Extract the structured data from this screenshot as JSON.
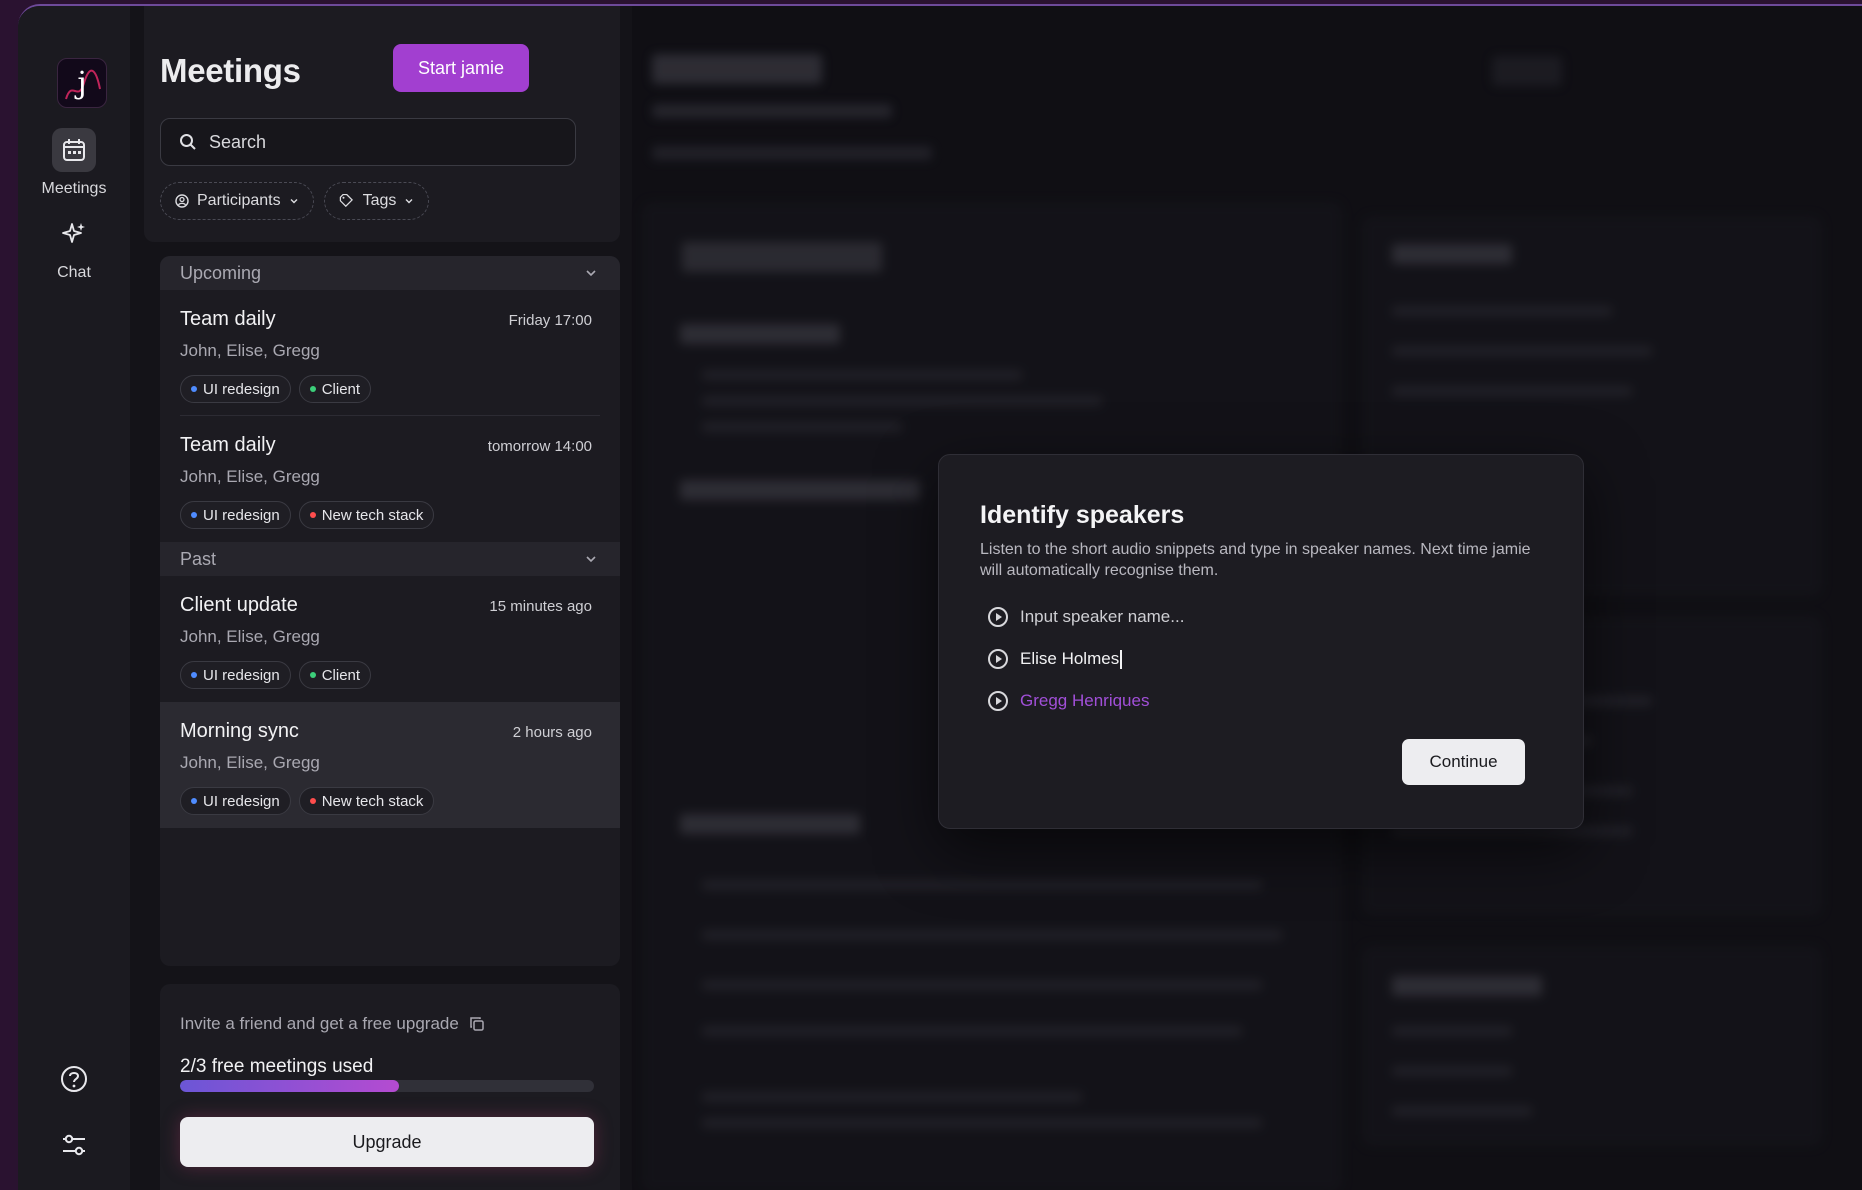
{
  "rail": {
    "logo_letter": "j",
    "items": [
      {
        "label": "Meetings",
        "icon": "calendar-icon",
        "active": true
      },
      {
        "label": "Chat",
        "icon": "sparkle-icon",
        "active": false
      }
    ],
    "bottom_icons": [
      "help-icon",
      "settings-sliders-icon"
    ]
  },
  "panel": {
    "title": "Meetings",
    "start_button": "Start jamie",
    "search_placeholder": "Search",
    "filters": [
      {
        "label": "Participants",
        "icon": "person-circle-icon"
      },
      {
        "label": "Tags",
        "icon": "tag-icon"
      }
    ]
  },
  "sections": {
    "upcoming": {
      "label": "Upcoming",
      "meetings": [
        {
          "title": "Team daily",
          "time": "Friday 17:00",
          "people": "John, Elise, Gregg",
          "tags": [
            {
              "label": "UI redesign",
              "color": "#4f8cff"
            },
            {
              "label": "Client",
              "color": "#3ccf7a"
            }
          ]
        },
        {
          "title": "Team daily",
          "time": "tomorrow 14:00",
          "people": "John, Elise, Gregg",
          "tags": [
            {
              "label": "UI redesign",
              "color": "#4f8cff"
            },
            {
              "label": "New tech stack",
              "color": "#ff4d4d"
            }
          ]
        }
      ]
    },
    "past": {
      "label": "Past",
      "meetings": [
        {
          "title": "Client update",
          "time": "15 minutes ago",
          "people": "John, Elise, Gregg",
          "tags": [
            {
              "label": "UI redesign",
              "color": "#4f8cff"
            },
            {
              "label": "Client",
              "color": "#3ccf7a"
            }
          ]
        },
        {
          "title": "Morning sync",
          "time": "2 hours ago",
          "people": "John, Elise, Gregg",
          "tags": [
            {
              "label": "UI redesign",
              "color": "#4f8cff"
            },
            {
              "label": "New tech stack",
              "color": "#ff4d4d"
            }
          ]
        }
      ]
    }
  },
  "promo": {
    "invite_text": "Invite a friend and get a free upgrade",
    "usage_text": "2/3 free meetings used",
    "usage_fraction": 0.53,
    "upgrade_button": "Upgrade"
  },
  "modal": {
    "title": "Identify speakers",
    "subtitle": "Listen to the short audio snippets and type in speaker names. Next time jamie will automatically recognise them.",
    "speakers": [
      {
        "value": "",
        "placeholder": "Input speaker name...",
        "color": "#cfcfd4"
      },
      {
        "value": "Elise Holmes",
        "placeholder": "",
        "color": "#f2f2f4"
      },
      {
        "value": "Gregg Henriques",
        "placeholder": "",
        "color": "#a14fd8"
      }
    ],
    "continue_button": "Continue"
  },
  "colors": {
    "accent": "#a23fd0",
    "background": "#141318",
    "panel": "#1c1b21"
  }
}
